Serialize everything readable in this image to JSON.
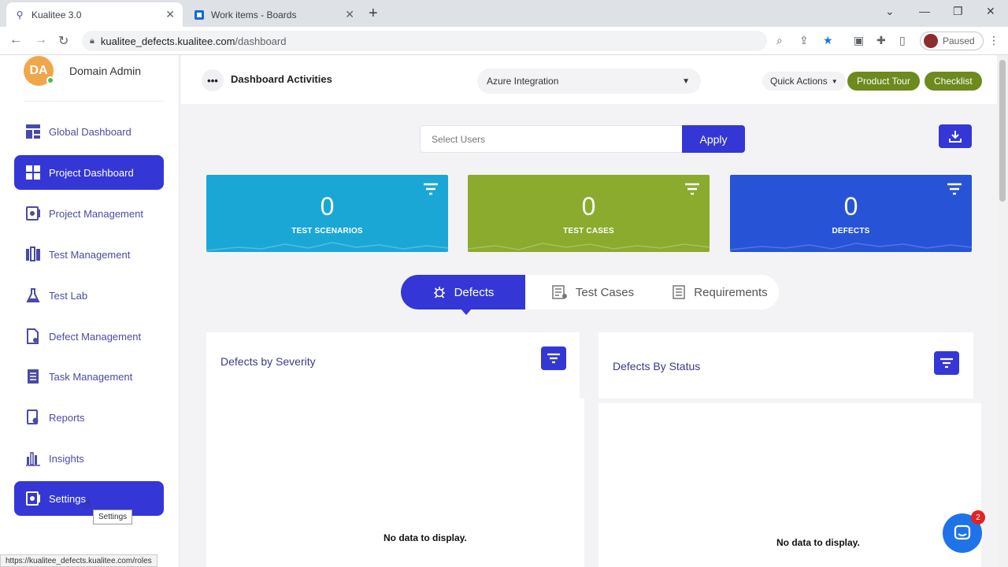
{
  "browser": {
    "tabs": [
      {
        "title": "Kualitee 3.0",
        "active": true
      },
      {
        "title": "Work items - Boards",
        "active": false
      }
    ],
    "url_host": "kualitee_defects.kualitee.com",
    "url_path": "/dashboard",
    "profile_status": "Paused",
    "status_url": "https://kualitee_defects.kualitee.com/roles"
  },
  "user": {
    "initials": "DA",
    "name": "Domain Admin"
  },
  "sidebar": {
    "items": [
      {
        "label": "Global Dashboard",
        "icon": "dashboard-grid-icon",
        "active": false
      },
      {
        "label": "Project Dashboard",
        "icon": "dashboard-tiles-icon",
        "active": true
      },
      {
        "label": "Project Management",
        "icon": "project-management-icon",
        "active": false
      },
      {
        "label": "Test Management",
        "icon": "test-management-icon",
        "active": false
      },
      {
        "label": "Test Lab",
        "icon": "flask-icon",
        "active": false
      },
      {
        "label": "Defect Management",
        "icon": "defect-document-icon",
        "active": false
      },
      {
        "label": "Task Management",
        "icon": "task-management-icon",
        "active": false
      },
      {
        "label": "Reports",
        "icon": "reports-icon",
        "active": false
      },
      {
        "label": "Insights",
        "icon": "bar-chart-icon",
        "active": false
      },
      {
        "label": "Settings",
        "icon": "settings-icon",
        "active": true
      }
    ],
    "tooltip": "Settings"
  },
  "header": {
    "title": "Dashboard Activities",
    "project": "Azure Integration",
    "quick_actions": "Quick Actions",
    "product_tour": "Product Tour",
    "checklist": "Checklist"
  },
  "filters": {
    "select_users_placeholder": "Select Users",
    "apply": "Apply"
  },
  "stats": [
    {
      "value": "0",
      "label": "TEST SCENARIOS",
      "color": "#1aa7d6"
    },
    {
      "value": "0",
      "label": "TEST CASES",
      "color": "#8aab2d"
    },
    {
      "value": "0",
      "label": "DEFECTS",
      "color": "#2754d6"
    }
  ],
  "tabs": [
    {
      "label": "Defects",
      "active": true
    },
    {
      "label": "Test Cases",
      "active": false
    },
    {
      "label": "Requirements",
      "active": false
    }
  ],
  "panels": [
    {
      "title": "Defects by Severity",
      "empty": "No data to display."
    },
    {
      "title": "Defects By Status",
      "empty": "No data to display."
    }
  ],
  "chat": {
    "badge": "2"
  },
  "colors": {
    "primary": "#3437d5",
    "green": "#6c8a1e"
  }
}
